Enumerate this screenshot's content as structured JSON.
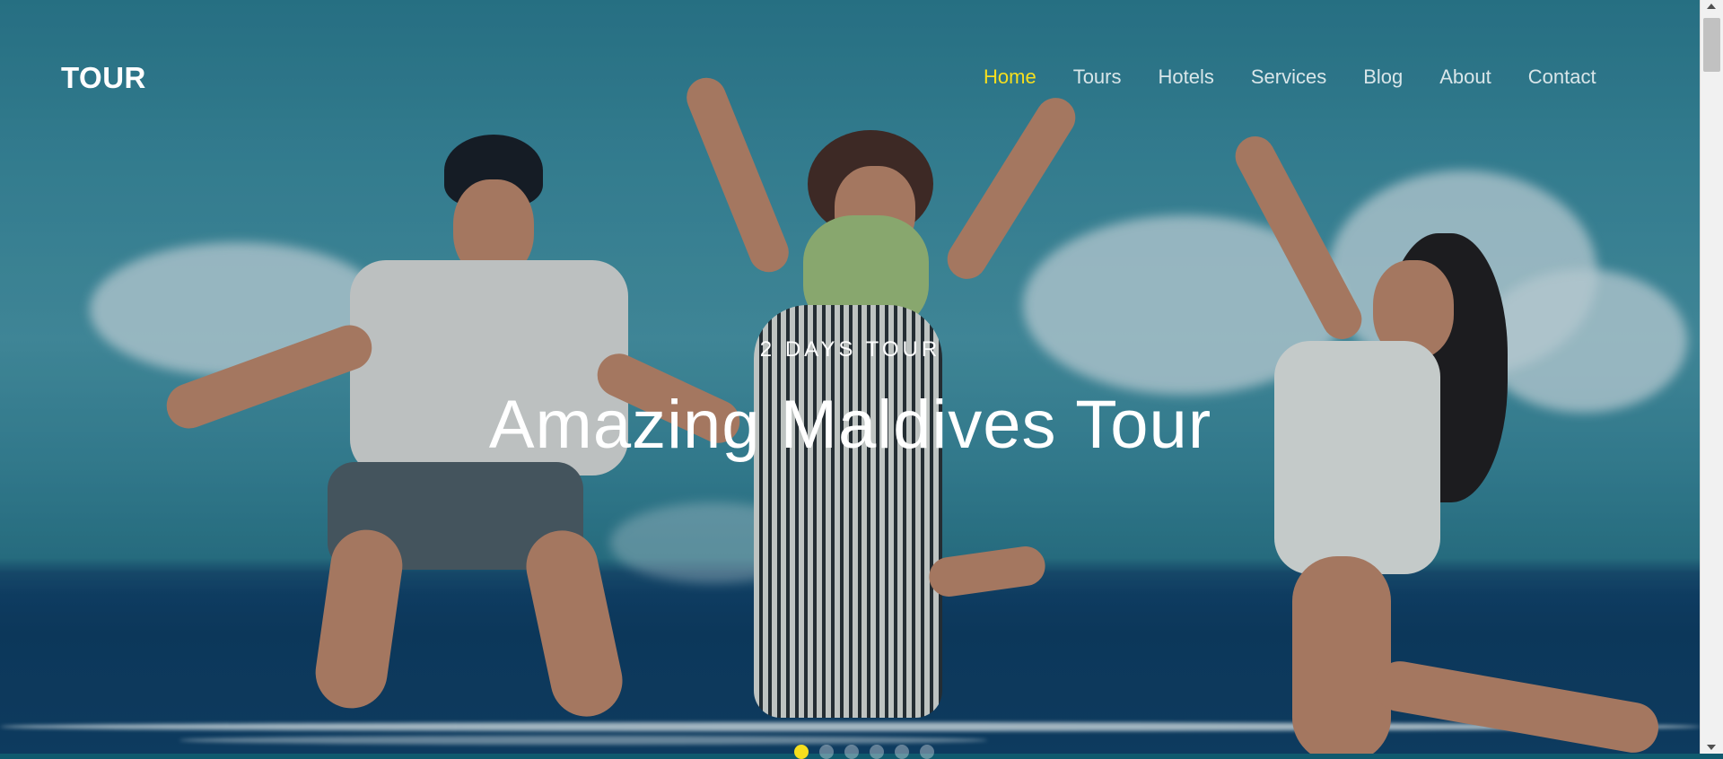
{
  "brand": {
    "logo": "TOUR"
  },
  "nav": {
    "items": [
      {
        "label": "Home",
        "active": true
      },
      {
        "label": "Tours",
        "active": false
      },
      {
        "label": "Hotels",
        "active": false
      },
      {
        "label": "Services",
        "active": false
      },
      {
        "label": "Blog",
        "active": false
      },
      {
        "label": "About",
        "active": false
      },
      {
        "label": "Contact",
        "active": false
      }
    ]
  },
  "hero": {
    "subtitle": "2 DAYS TOUR",
    "title": "Amazing Maldives Tour",
    "slide_count": 6,
    "active_slide": 1
  },
  "colors": {
    "accent": "#f7df1e",
    "text": "#ffffff"
  }
}
